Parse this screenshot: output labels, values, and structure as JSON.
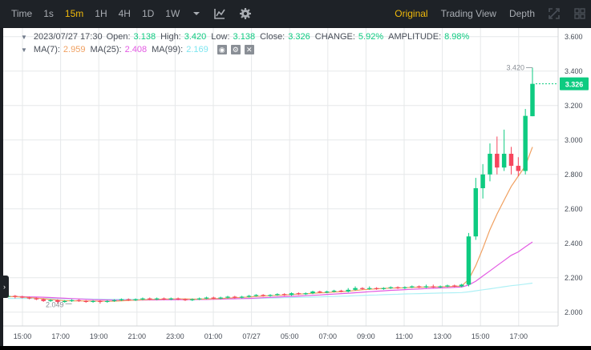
{
  "toolbar": {
    "intervals": [
      "Time",
      "1s",
      "15m",
      "1H",
      "4H",
      "1D",
      "1W"
    ],
    "active_interval": "15m",
    "views": [
      "Original",
      "Trading View",
      "Depth"
    ],
    "active_view": "Original"
  },
  "legend": {
    "datetime": "2023/07/27 17:30",
    "open_label": "Open:",
    "open": "3.138",
    "high_label": "High:",
    "high": "3.420",
    "low_label": "Low:",
    "low": "3.138",
    "close_label": "Close:",
    "close": "3.326",
    "change_label": "CHANGE:",
    "change": "5.92%",
    "amplitude_label": "AMPLITUDE:",
    "amplitude": "8.98%",
    "ma7_label": "MA(7):",
    "ma7": "2.959",
    "ma25_label": "MA(25):",
    "ma25": "2.408",
    "ma99_label": "MA(99):",
    "ma99": "2.169"
  },
  "colors": {
    "up": "#0ecb81",
    "down": "#f6465d",
    "ma7": "#f0a060",
    "ma25": "#e35ae3",
    "ma99": "#aef0f5",
    "accent": "#f0b90b"
  },
  "chart_data": {
    "type": "candlestick",
    "y_ticks": [
      "3.600",
      "3.400",
      "3.200",
      "3.000",
      "2.800",
      "2.600",
      "2.400",
      "2.200",
      "2.000"
    ],
    "x_ticks": [
      "15:00",
      "17:00",
      "19:00",
      "21:00",
      "23:00",
      "01:00",
      "07/27",
      "05:00",
      "07:00",
      "09:00",
      "11:00",
      "13:00",
      "15:00",
      "17:00"
    ],
    "ylim": [
      1.92,
      3.65
    ],
    "last_price": "3.326",
    "high_marker": "3.420",
    "low_marker": "2.049",
    "candles": [
      [
        2.09,
        2.095,
        2.1,
        2.085
      ],
      [
        2.095,
        2.09,
        2.1,
        2.08
      ],
      [
        2.09,
        2.085,
        2.095,
        2.08
      ],
      [
        2.085,
        2.08,
        2.09,
        2.075
      ],
      [
        2.08,
        2.075,
        2.085,
        2.07
      ],
      [
        2.075,
        2.065,
        2.08,
        2.06
      ],
      [
        2.065,
        2.07,
        2.075,
        2.06
      ],
      [
        2.07,
        2.06,
        2.075,
        2.05
      ],
      [
        2.06,
        2.065,
        2.07,
        2.055
      ],
      [
        2.065,
        2.07,
        2.075,
        2.06
      ],
      [
        2.07,
        2.065,
        2.075,
        2.06
      ],
      [
        2.065,
        2.06,
        2.07,
        2.055
      ],
      [
        2.06,
        2.065,
        2.07,
        2.055
      ],
      [
        2.065,
        2.06,
        2.07,
        2.05
      ],
      [
        2.06,
        2.065,
        2.07,
        2.055
      ],
      [
        2.065,
        2.07,
        2.075,
        2.06
      ],
      [
        2.07,
        2.075,
        2.08,
        2.065
      ],
      [
        2.075,
        2.07,
        2.08,
        2.065
      ],
      [
        2.07,
        2.075,
        2.08,
        2.065
      ],
      [
        2.075,
        2.08,
        2.085,
        2.07
      ],
      [
        2.08,
        2.075,
        2.085,
        2.07
      ],
      [
        2.075,
        2.08,
        2.085,
        2.07
      ],
      [
        2.08,
        2.075,
        2.085,
        2.07
      ],
      [
        2.075,
        2.08,
        2.085,
        2.07
      ],
      [
        2.08,
        2.075,
        2.085,
        2.07
      ],
      [
        2.075,
        2.07,
        2.08,
        2.065
      ],
      [
        2.07,
        2.075,
        2.08,
        2.065
      ],
      [
        2.075,
        2.08,
        2.085,
        2.07
      ],
      [
        2.08,
        2.085,
        2.09,
        2.075
      ],
      [
        2.085,
        2.08,
        2.09,
        2.075
      ],
      [
        2.08,
        2.085,
        2.09,
        2.075
      ],
      [
        2.085,
        2.09,
        2.095,
        2.08
      ],
      [
        2.09,
        2.085,
        2.095,
        2.08
      ],
      [
        2.085,
        2.09,
        2.095,
        2.08
      ],
      [
        2.09,
        2.095,
        2.1,
        2.085
      ],
      [
        2.095,
        2.1,
        2.105,
        2.09
      ],
      [
        2.1,
        2.095,
        2.105,
        2.09
      ],
      [
        2.095,
        2.1,
        2.105,
        2.09
      ],
      [
        2.1,
        2.105,
        2.11,
        2.095
      ],
      [
        2.105,
        2.1,
        2.11,
        2.095
      ],
      [
        2.1,
        2.11,
        2.115,
        2.095
      ],
      [
        2.11,
        2.105,
        2.115,
        2.1
      ],
      [
        2.105,
        2.11,
        2.115,
        2.1
      ],
      [
        2.11,
        2.12,
        2.125,
        2.105
      ],
      [
        2.12,
        2.115,
        2.125,
        2.11
      ],
      [
        2.115,
        2.12,
        2.125,
        2.11
      ],
      [
        2.12,
        2.125,
        2.13,
        2.115
      ],
      [
        2.125,
        2.12,
        2.13,
        2.115
      ],
      [
        2.12,
        2.13,
        2.14,
        2.115
      ],
      [
        2.13,
        2.14,
        2.15,
        2.125
      ],
      [
        2.14,
        2.135,
        2.145,
        2.13
      ],
      [
        2.135,
        2.14,
        2.15,
        2.13
      ],
      [
        2.14,
        2.135,
        2.145,
        2.13
      ],
      [
        2.135,
        2.14,
        2.145,
        2.13
      ],
      [
        2.14,
        2.145,
        2.15,
        2.135
      ],
      [
        2.145,
        2.14,
        2.15,
        2.135
      ],
      [
        2.14,
        2.145,
        2.15,
        2.135
      ],
      [
        2.145,
        2.15,
        2.155,
        2.14
      ],
      [
        2.15,
        2.145,
        2.155,
        2.14
      ],
      [
        2.145,
        2.15,
        2.16,
        2.14
      ],
      [
        2.15,
        2.145,
        2.16,
        2.14
      ],
      [
        2.145,
        2.15,
        2.155,
        2.14
      ],
      [
        2.15,
        2.155,
        2.16,
        2.145
      ],
      [
        2.155,
        2.15,
        2.16,
        2.145
      ],
      [
        2.15,
        2.16,
        2.165,
        2.145
      ],
      [
        2.16,
        2.44,
        2.46,
        2.15
      ],
      [
        2.44,
        2.72,
        2.78,
        2.42
      ],
      [
        2.72,
        2.8,
        2.86,
        2.66
      ],
      [
        2.8,
        2.92,
        2.98,
        2.76
      ],
      [
        2.92,
        2.84,
        3.02,
        2.8
      ],
      [
        2.84,
        2.92,
        3.06,
        2.82
      ],
      [
        2.92,
        2.85,
        2.96,
        2.8
      ],
      [
        2.85,
        2.82,
        2.9,
        2.79
      ],
      [
        2.82,
        3.14,
        3.18,
        2.8
      ],
      [
        3.138,
        3.326,
        3.42,
        3.138
      ]
    ],
    "ma7": [
      2.09,
      2.09,
      2.088,
      2.085,
      2.082,
      2.078,
      2.074,
      2.07,
      2.067,
      2.066,
      2.066,
      2.065,
      2.064,
      2.064,
      2.063,
      2.064,
      2.066,
      2.068,
      2.07,
      2.072,
      2.074,
      2.075,
      2.076,
      2.077,
      2.077,
      2.077,
      2.076,
      2.076,
      2.077,
      2.078,
      2.08,
      2.082,
      2.084,
      2.086,
      2.088,
      2.091,
      2.094,
      2.096,
      2.098,
      2.1,
      2.103,
      2.105,
      2.107,
      2.11,
      2.112,
      2.114,
      2.117,
      2.119,
      2.122,
      2.126,
      2.13,
      2.133,
      2.136,
      2.138,
      2.14,
      2.141,
      2.142,
      2.144,
      2.145,
      2.146,
      2.147,
      2.148,
      2.149,
      2.15,
      2.152,
      2.19,
      2.27,
      2.37,
      2.48,
      2.57,
      2.65,
      2.73,
      2.79,
      2.85,
      2.959
    ],
    "ma25": [
      2.09,
      2.09,
      2.09,
      2.089,
      2.088,
      2.087,
      2.085,
      2.083,
      2.081,
      2.079,
      2.077,
      2.075,
      2.073,
      2.072,
      2.071,
      2.07,
      2.07,
      2.07,
      2.07,
      2.07,
      2.071,
      2.071,
      2.072,
      2.072,
      2.073,
      2.073,
      2.073,
      2.074,
      2.074,
      2.075,
      2.076,
      2.077,
      2.078,
      2.079,
      2.08,
      2.082,
      2.084,
      2.086,
      2.088,
      2.09,
      2.092,
      2.094,
      2.096,
      2.098,
      2.1,
      2.103,
      2.105,
      2.108,
      2.11,
      2.113,
      2.116,
      2.119,
      2.122,
      2.124,
      2.127,
      2.129,
      2.131,
      2.133,
      2.135,
      2.137,
      2.139,
      2.141,
      2.142,
      2.144,
      2.146,
      2.158,
      2.18,
      2.21,
      2.24,
      2.27,
      2.3,
      2.33,
      2.35,
      2.38,
      2.408
    ],
    "ma99": [
      2.08,
      2.08,
      2.08,
      2.08,
      2.08,
      2.08,
      2.079,
      2.079,
      2.078,
      2.078,
      2.077,
      2.077,
      2.076,
      2.076,
      2.075,
      2.075,
      2.075,
      2.075,
      2.075,
      2.075,
      2.075,
      2.075,
      2.075,
      2.075,
      2.075,
      2.075,
      2.076,
      2.076,
      2.076,
      2.077,
      2.077,
      2.078,
      2.078,
      2.079,
      2.08,
      2.08,
      2.081,
      2.082,
      2.083,
      2.084,
      2.085,
      2.086,
      2.087,
      2.088,
      2.089,
      2.09,
      2.091,
      2.093,
      2.094,
      2.096,
      2.097,
      2.099,
      2.1,
      2.102,
      2.103,
      2.104,
      2.106,
      2.107,
      2.108,
      2.109,
      2.11,
      2.111,
      2.112,
      2.113,
      2.114,
      2.118,
      2.124,
      2.13,
      2.136,
      2.142,
      2.148,
      2.154,
      2.158,
      2.163,
      2.169
    ]
  }
}
